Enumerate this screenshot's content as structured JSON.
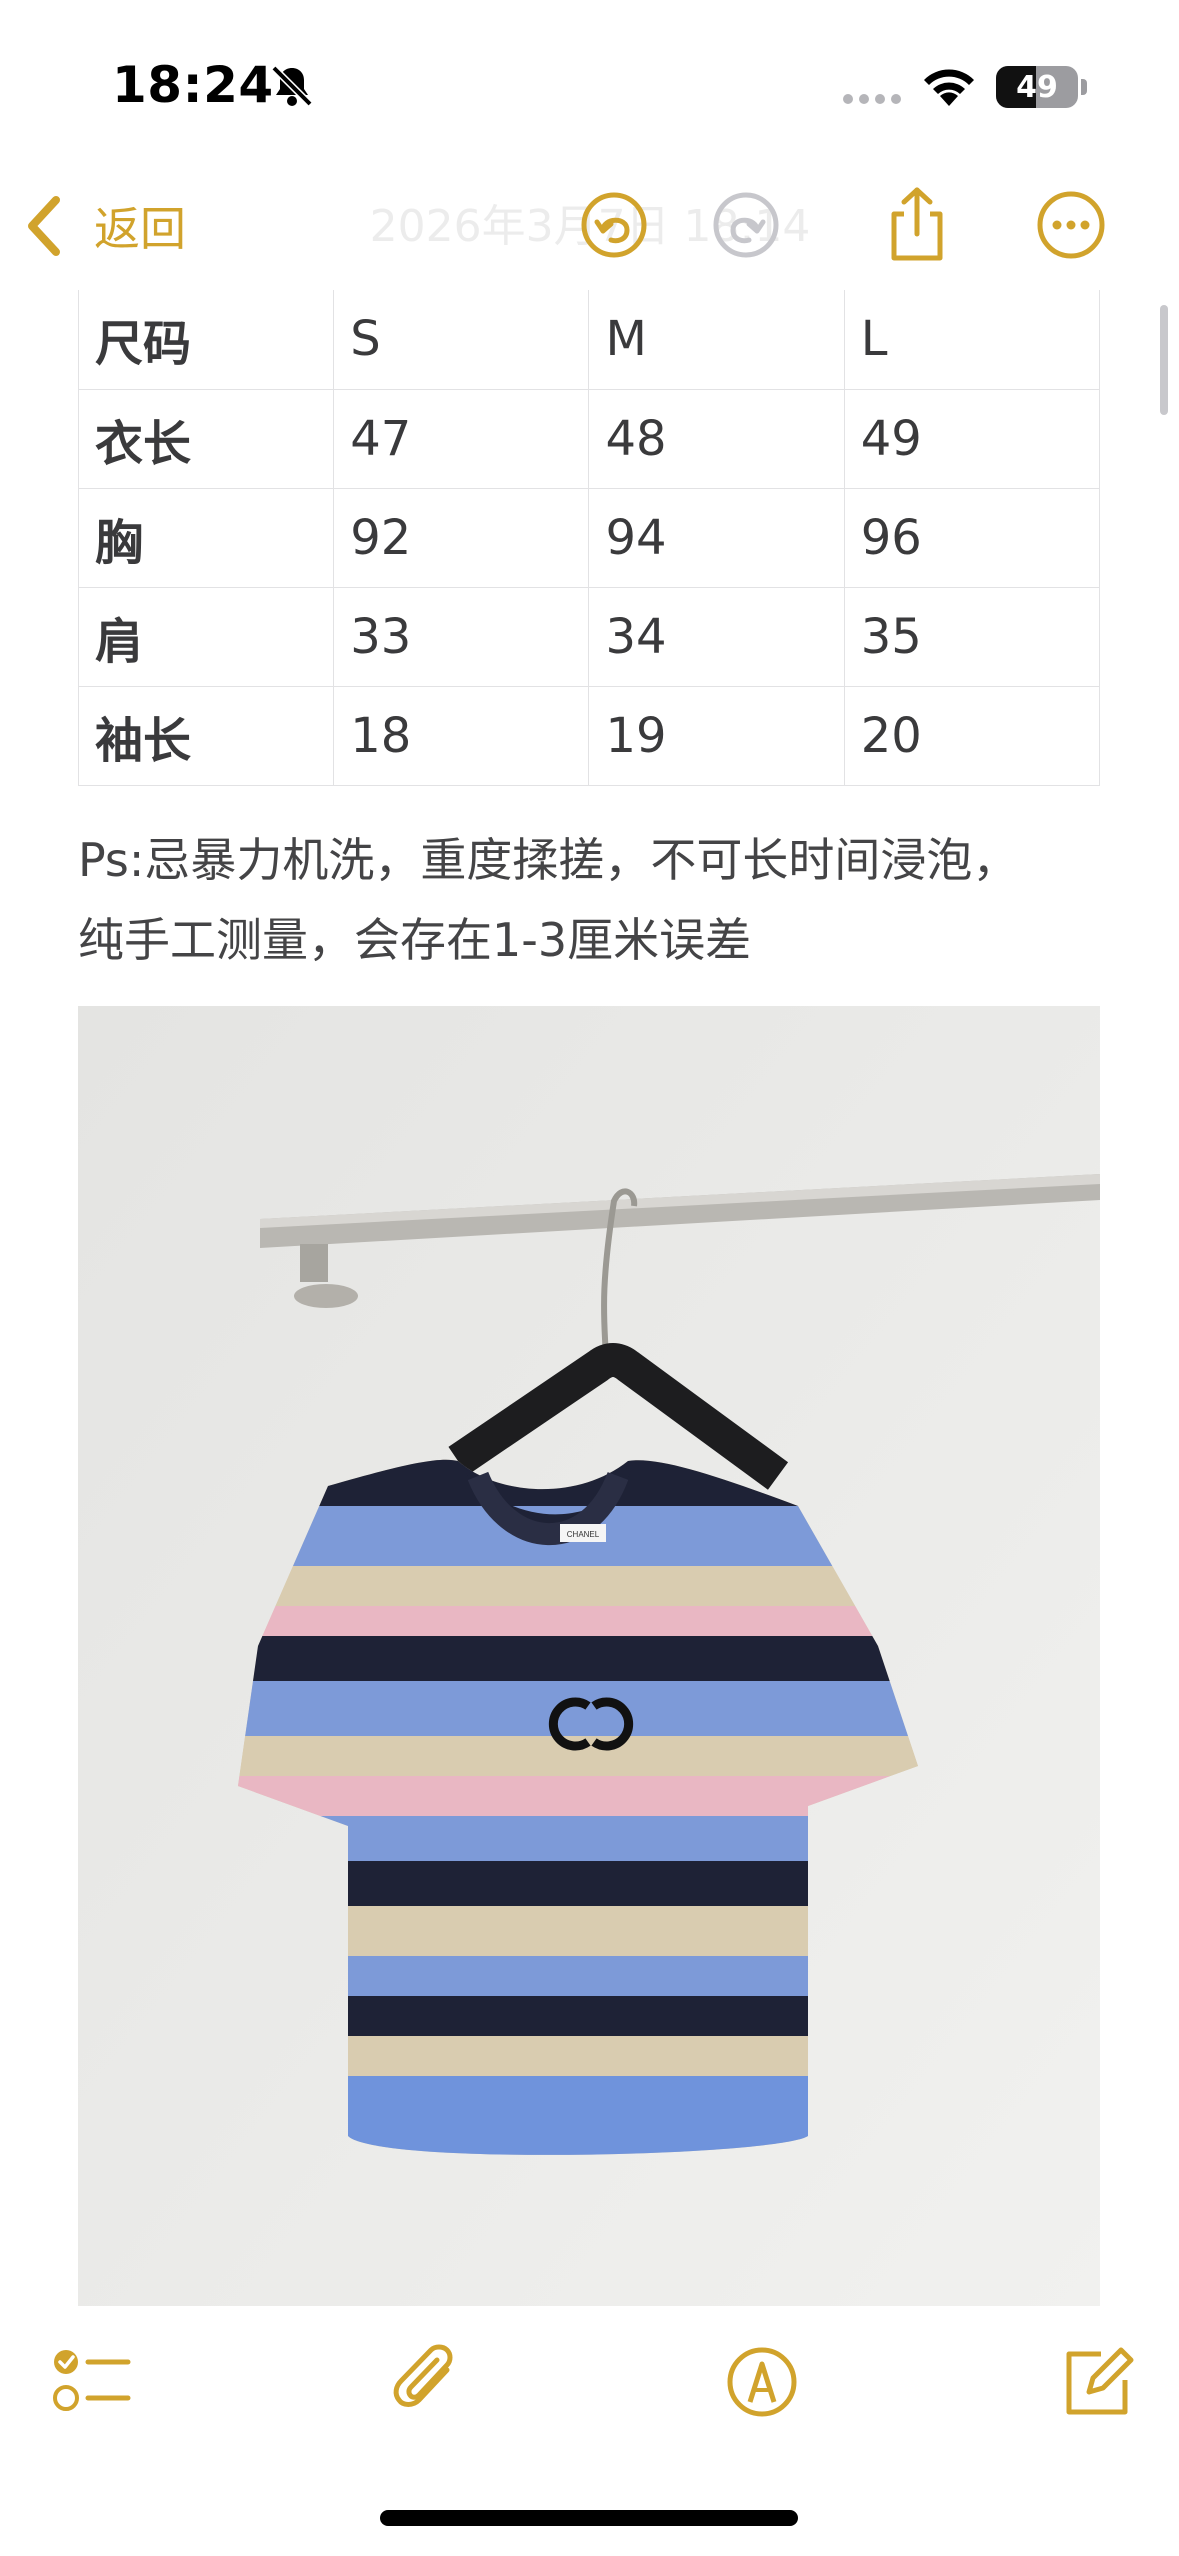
{
  "status_bar": {
    "time": "18:24",
    "battery_percent": 49,
    "battery_label": "49"
  },
  "nav": {
    "back_label": "返回",
    "title": "2026年3月7日 18:14",
    "icons": [
      "undo-icon",
      "redo-icon",
      "share-icon",
      "more-icon"
    ]
  },
  "size_table": {
    "header": [
      "尺码",
      "S",
      "M",
      "L"
    ],
    "rows": [
      [
        "衣长",
        "47",
        "48",
        "49"
      ],
      [
        "胸",
        "92",
        "94",
        "96"
      ],
      [
        "肩",
        "33",
        "34",
        "35"
      ],
      [
        "袖长",
        "18",
        "19",
        "20"
      ]
    ]
  },
  "note": {
    "line1": "Ps:忌暴力机洗，重度揉搓，不可长时间浸泡，",
    "line2": "纯手工测量，会存在1-3厘米误差"
  },
  "photo": {
    "label_text": "CHANEL"
  },
  "toolbar": {
    "icons": [
      "checklist-icon",
      "paperclip-icon",
      "markup-pen-icon",
      "compose-icon"
    ]
  },
  "colors": {
    "accent": "#d1a32c",
    "text": "#3a3a3c"
  }
}
